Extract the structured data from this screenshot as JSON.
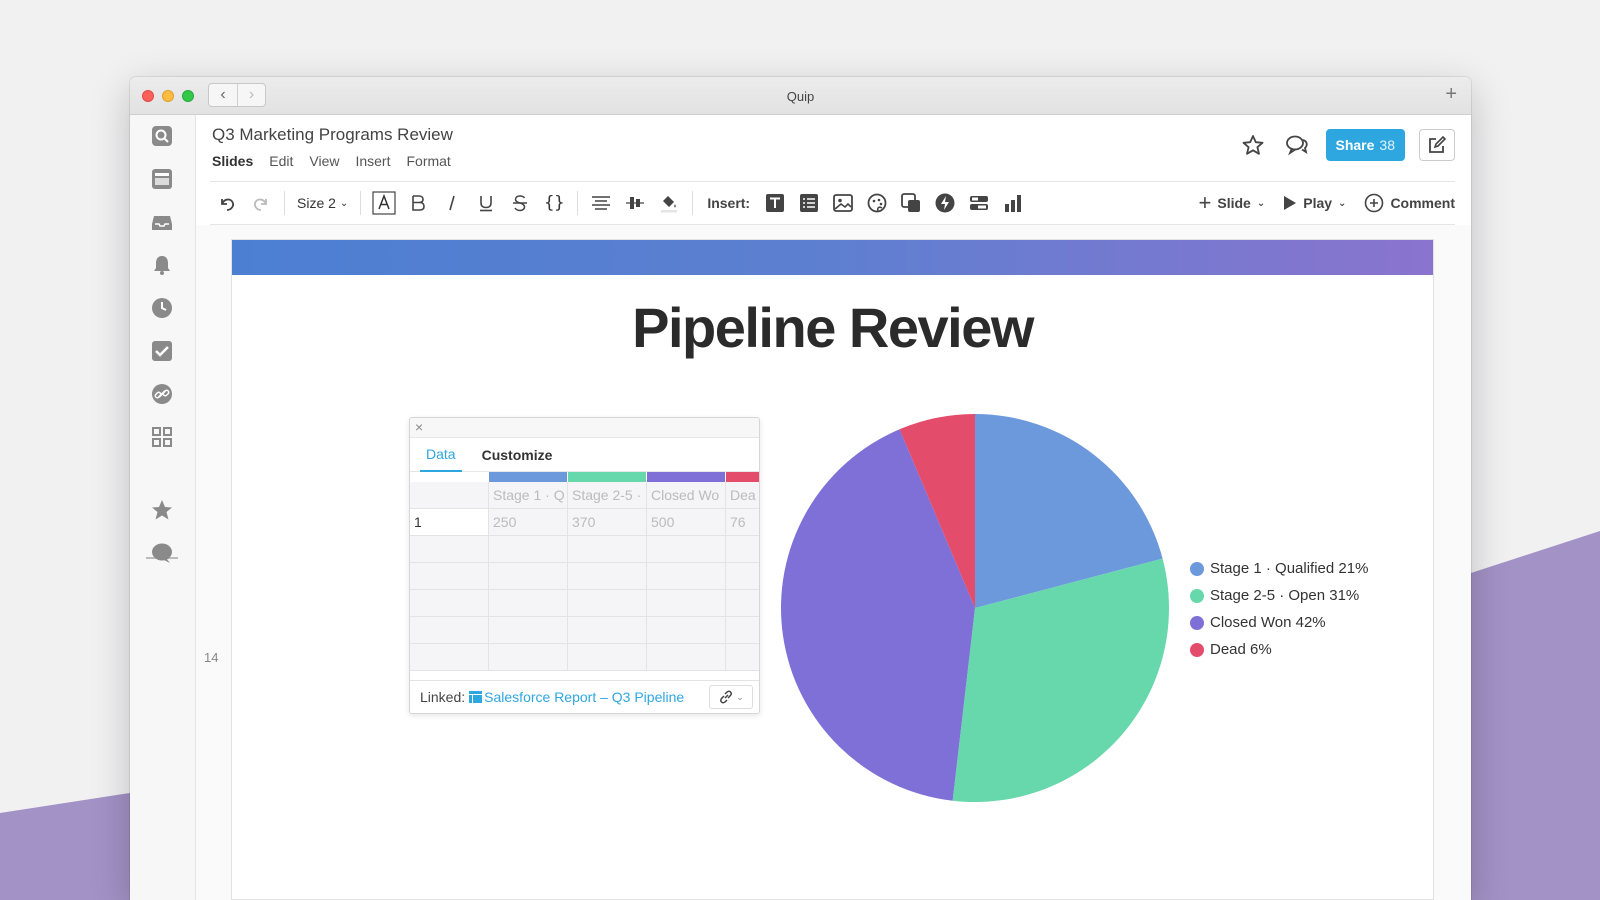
{
  "window": {
    "title": "Quip"
  },
  "header": {
    "doc_title": "Q3 Marketing Programs Review",
    "menu": [
      "Slides",
      "Edit",
      "View",
      "Insert",
      "Format"
    ],
    "share_label": "Share",
    "share_count": "38"
  },
  "toolbar": {
    "size_label": "Size 2",
    "insert_label": "Insert:",
    "slide_label": "Slide",
    "play_label": "Play",
    "comment_label": "Comment"
  },
  "canvas": {
    "slide_number": "14"
  },
  "slide": {
    "title": "Pipeline Review"
  },
  "panel": {
    "tabs": [
      "Data",
      "Customize"
    ],
    "columns": [
      "Stage 1 · Q",
      "Stage 2-5 ·",
      "Closed Wo",
      "Dea"
    ],
    "row": {
      "index": "1",
      "values": [
        "250",
        "370",
        "500",
        "76"
      ]
    },
    "linked_label": "Linked:",
    "linked_source": "Salesforce Report – Q3 Pipeline"
  },
  "chart_data": {
    "type": "pie",
    "categories": [
      "Stage 1 · Qualified",
      "Stage 2-5 · Open",
      "Closed Won",
      "Dead"
    ],
    "values": [
      250,
      370,
      500,
      76
    ],
    "legend_labels": [
      "Stage 1 · Qualified 21%",
      "Stage 2-5 · Open 31%",
      "Closed Won 42%",
      "Dead 6%"
    ],
    "colors": [
      "#6c98dc",
      "#67d8ab",
      "#7f70d8",
      "#e34c6b"
    ],
    "legend_position": "right"
  }
}
